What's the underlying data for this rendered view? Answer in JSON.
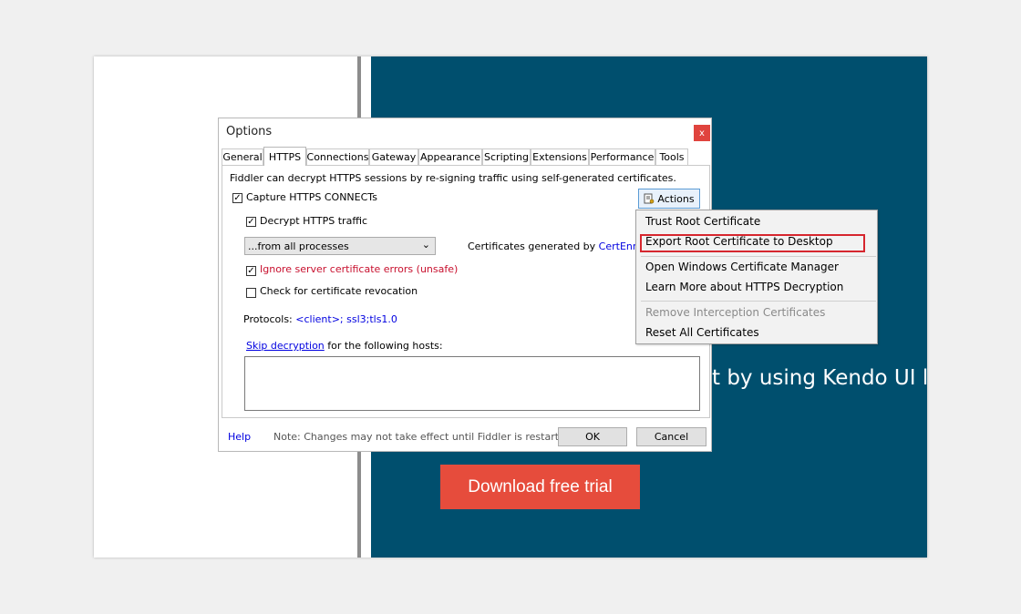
{
  "background_page": {
    "hero_text": "t by using Kendo UI l",
    "cta_label": "Download free trial",
    "bg_color": "#004f6e",
    "cta_color": "#e64c3c"
  },
  "dialog": {
    "title": "Options",
    "close_glyph": "x",
    "tabs": [
      {
        "label": "General"
      },
      {
        "label": "HTTPS"
      },
      {
        "label": "Connections"
      },
      {
        "label": "Gateway"
      },
      {
        "label": "Appearance"
      },
      {
        "label": "Scripting"
      },
      {
        "label": "Extensions"
      },
      {
        "label": "Performance"
      },
      {
        "label": "Tools"
      }
    ],
    "active_tab": "HTTPS",
    "https": {
      "description": "Fiddler can decrypt HTTPS sessions by re-signing traffic using self-generated certificates.",
      "capture_label": "Capture HTTPS CONNECTs",
      "capture_checked": true,
      "decrypt_label": "Decrypt HTTPS traffic",
      "decrypt_checked": true,
      "process_filter": "...from all processes",
      "cert_generated_prefix": "Certificates generated by",
      "cert_generated_link": "CertEnroll e",
      "ignore_errors_label": "Ignore server certificate errors (unsafe)",
      "ignore_errors_checked": true,
      "revocation_label": "Check for certificate revocation",
      "revocation_checked": false,
      "protocols_label": "Protocols:",
      "protocols_value": "<client>; ssl3;tls1.0",
      "skip_link": "Skip decryption",
      "skip_suffix": "for the following hosts:",
      "hosts_value": "",
      "actions_label": "Actions"
    },
    "footer": {
      "help_label": "Help",
      "note": "Note: Changes may not take effect until Fiddler is restarted.",
      "ok_label": "OK",
      "cancel_label": "Cancel"
    }
  },
  "actions_menu": {
    "items": [
      {
        "label": "Trust Root Certificate",
        "enabled": true
      },
      {
        "label": "Export Root Certificate to Desktop",
        "enabled": true,
        "highlighted": true
      },
      {
        "label": "Open Windows Certificate Manager",
        "enabled": true
      },
      {
        "label": "Learn More about HTTPS Decryption",
        "enabled": true
      },
      {
        "label": "Remove Interception Certificates",
        "enabled": false
      },
      {
        "label": "Reset All Certificates",
        "enabled": true
      }
    ],
    "highlight_color": "#d6262e"
  }
}
